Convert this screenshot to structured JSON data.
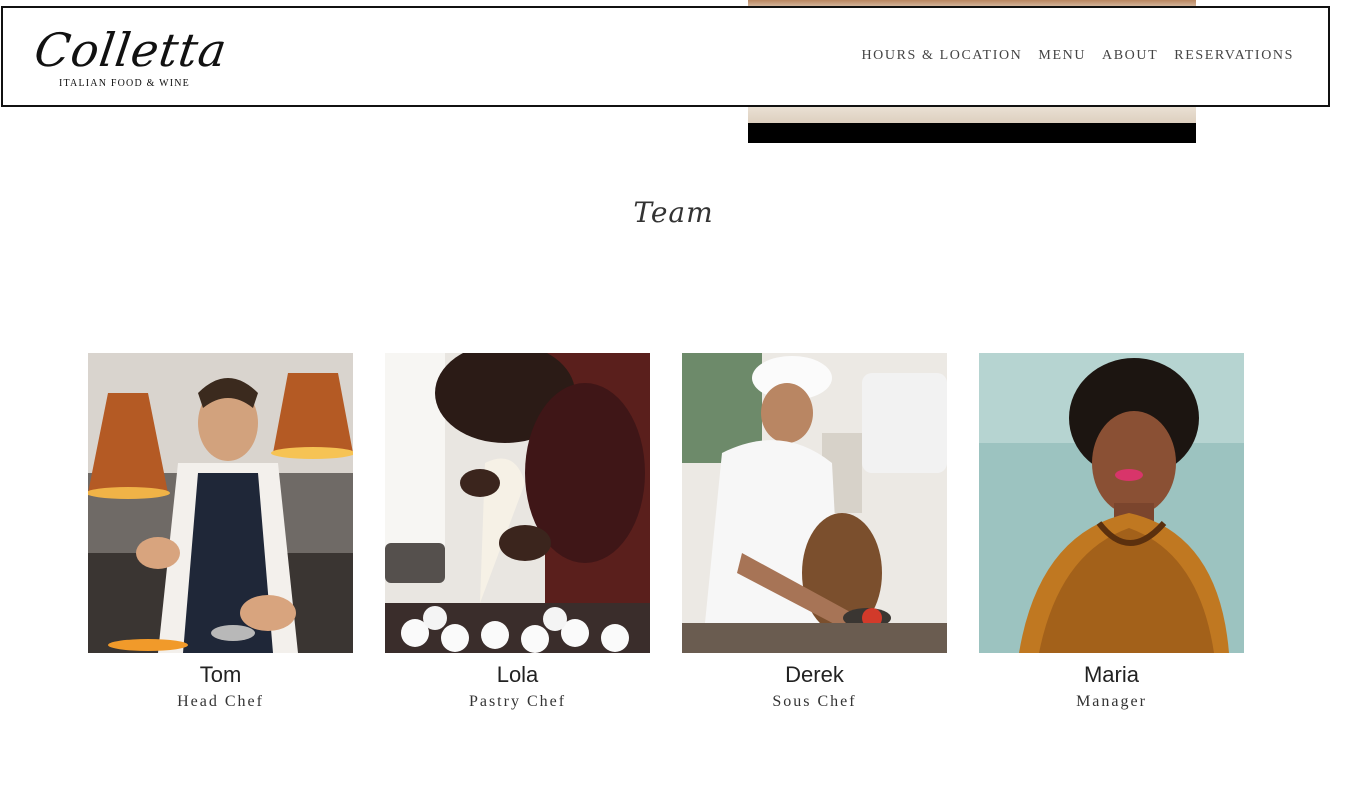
{
  "header": {
    "logo": {
      "name": "Colletta",
      "tagline": "ITALIAN FOOD & WINE"
    },
    "nav": [
      "HOURS & LOCATION",
      "MENU",
      "ABOUT",
      "RESERVATIONS"
    ]
  },
  "team": {
    "title": "Team",
    "members": [
      {
        "name": "Tom",
        "role": "Head Chef"
      },
      {
        "name": "Lola",
        "role": "Pastry Chef"
      },
      {
        "name": "Derek",
        "role": "Sous Chef"
      },
      {
        "name": "Maria",
        "role": "Manager"
      }
    ]
  }
}
